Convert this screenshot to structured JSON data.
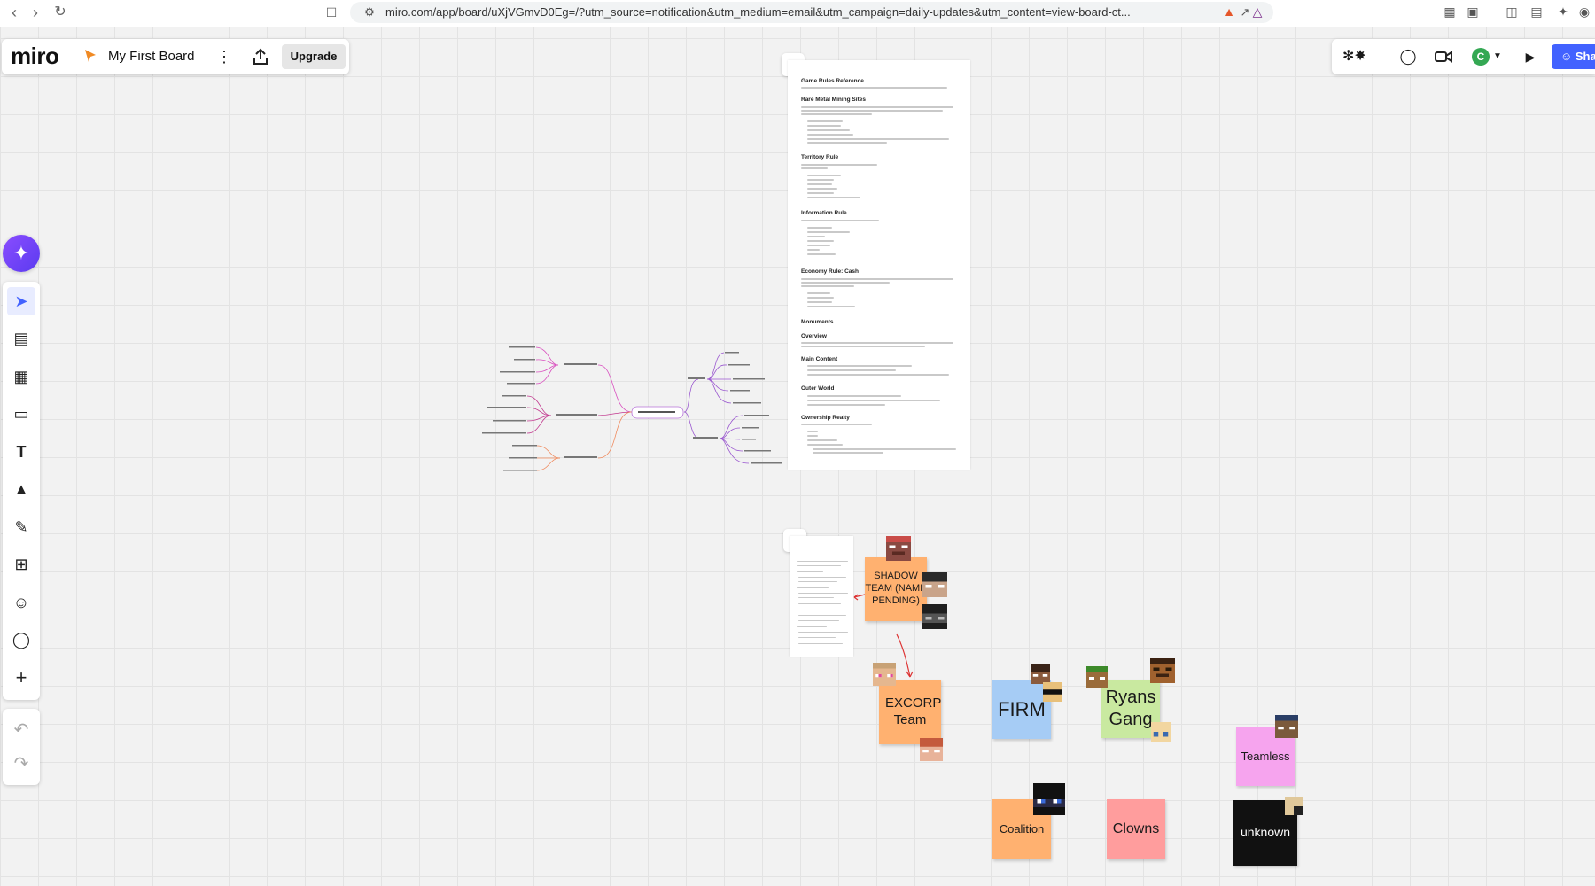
{
  "browser": {
    "url": "miro.com/app/board/uXjVGmvD0Eg=/?utm_source=notification&utm_medium=email&utm_campaign=daily-updates&utm_content=view-board-ct..."
  },
  "header": {
    "logo": "miro",
    "board_title": "My First Board",
    "upgrade_label": "Upgrade"
  },
  "collab": {
    "avatar_initial": "C",
    "share_label": "Share"
  },
  "rules_doc": {
    "title": "Game Rules Reference",
    "sections": [
      "Rare Metal Mining Sites",
      "Territory Rule",
      "Information Rule",
      "Economy Rule: Cash",
      "Monuments",
      "Overview",
      "Main Content",
      "Outer World",
      "Ownership Realty"
    ]
  },
  "stickies": {
    "shadow_team": "SHADOW TEAM (NAME PENDING)",
    "excorp": "EXCORP Team",
    "firm": "FIRM",
    "ryans_gang": "Ryans Gang",
    "teamless": "Teamless",
    "coalition": "Coalition",
    "clowns": "Clowns",
    "unknown": "unknown"
  },
  "colors": {
    "accent": "#4262ff",
    "orange_note": "#ffb170",
    "blue_note": "#a6ccf5",
    "green_note": "#c9e9a0",
    "pink_note": "#f6a4ee",
    "red_note": "#ff9d9d",
    "black_note": "#111111"
  }
}
